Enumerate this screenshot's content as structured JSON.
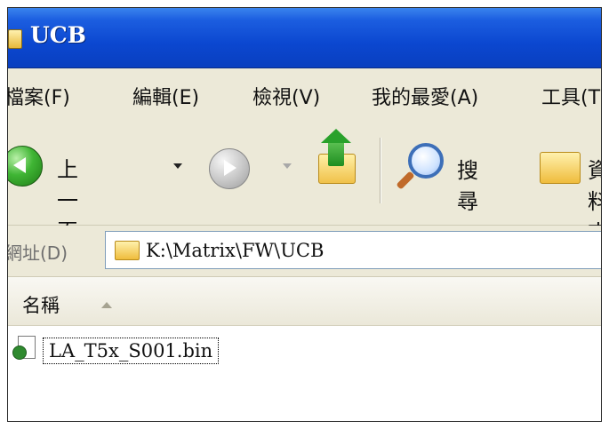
{
  "window": {
    "title": "UCB"
  },
  "menu": {
    "items": [
      "檔案(F)",
      "編輯(E)",
      "檢視(V)",
      "我的最愛(A)",
      "工具(T)"
    ]
  },
  "toolbar": {
    "back_label": "上一頁",
    "search_label": "搜尋",
    "folders_label": "資料夾"
  },
  "address": {
    "label": "網址(D)",
    "path": "K:\\Matrix\\FW\\UCB"
  },
  "columns": {
    "name": "名稱"
  },
  "files": [
    {
      "name": "LA_T5x_S001.bin",
      "icon": "system-file-icon"
    }
  ]
}
